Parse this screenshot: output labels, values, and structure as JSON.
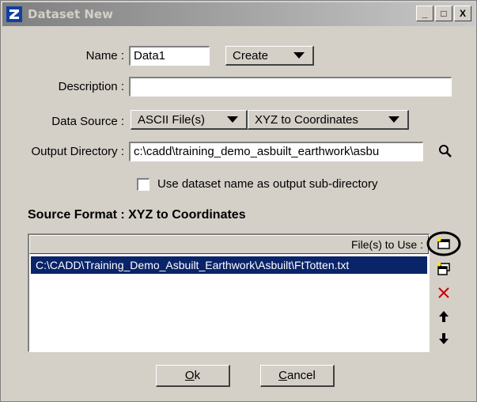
{
  "window": {
    "title": "Dataset New",
    "minimize": "_",
    "maximize": "□",
    "close": "X"
  },
  "name": {
    "label": "Name :",
    "value": "Data1",
    "create_dropdown": "Create"
  },
  "description": {
    "label": "Description :",
    "value": ""
  },
  "data_source": {
    "label": "Data Source :",
    "type": "ASCII File(s)",
    "format": "XYZ to Coordinates"
  },
  "output_directory": {
    "label": "Output Directory :",
    "value": "c:\\cadd\\training_demo_asbuilt_earthwork\\asbu"
  },
  "use_dataset_name": {
    "label": "Use dataset name as output sub-directory",
    "checked": false
  },
  "source_format": {
    "title": "Source Format : XYZ to Coordinates",
    "column_header": "File(s) to Use :",
    "files": [
      "C:\\CADD\\Training_Demo_Asbuilt_Earthwork\\Asbuilt\\FtTotten.txt"
    ]
  },
  "buttons": {
    "ok_mnemonic": "O",
    "ok_rest": "k",
    "cancel_mnemonic": "C",
    "cancel_rest": "ancel"
  },
  "icons": [
    "search-icon",
    "add-file-icon",
    "add-folder-icon",
    "delete-icon",
    "move-up-icon",
    "move-down-icon"
  ],
  "colors": {
    "titlebar_start": "#7f7f7f",
    "titlebar_end": "#c8c8c8",
    "selection": "#0a246a",
    "delete_red": "#cc0000",
    "highlight_ring": "#000000"
  }
}
